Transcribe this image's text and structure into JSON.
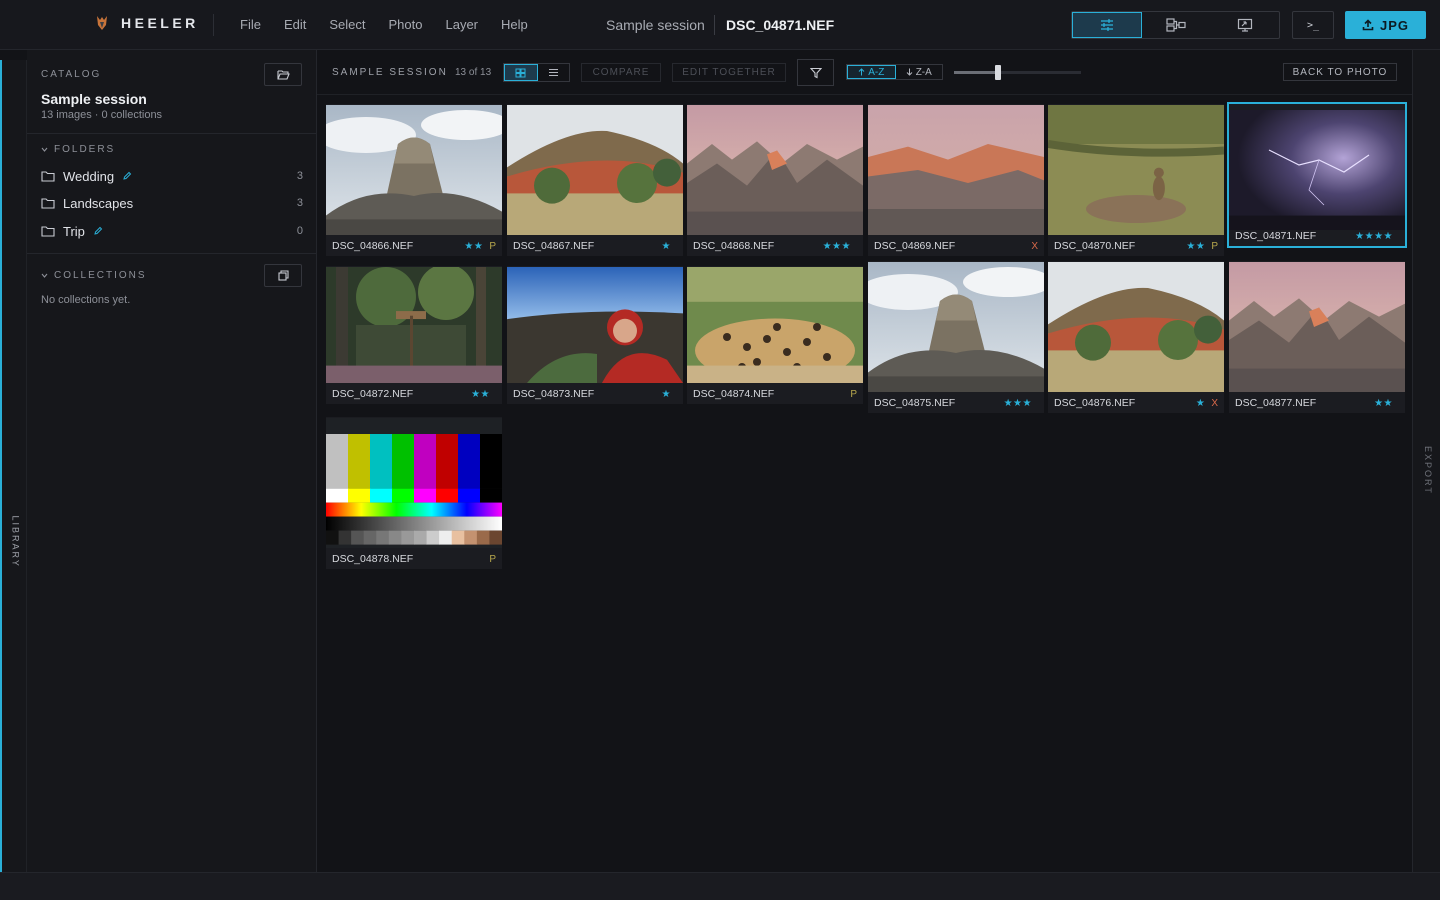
{
  "app": {
    "name": "HEELER"
  },
  "menu": [
    "File",
    "Edit",
    "Select",
    "Photo",
    "Layer",
    "Help"
  ],
  "header": {
    "session": "Sample session",
    "file": "DSC_04871.NEF",
    "export_label": "JPG",
    "terminal": ">_"
  },
  "left_panel": {
    "label": "LIBRARY"
  },
  "right_panel": {
    "label": "EXPORT"
  },
  "catalog": {
    "label": "CATALOG",
    "name": "Sample session",
    "summary": "13 images · 0 collections"
  },
  "folders": {
    "label": "FOLDERS",
    "items": [
      {
        "name": "Wedding",
        "count": "3",
        "editable": true
      },
      {
        "name": "Landscapes",
        "count": "3",
        "editable": false
      },
      {
        "name": "Trip",
        "count": "0",
        "editable": true
      }
    ]
  },
  "collections": {
    "label": "COLLECTIONS",
    "empty": "No collections yet."
  },
  "toolbar": {
    "title": "SAMPLE SESSION",
    "count": "13 of 13",
    "compare": "COMPARE",
    "edit_together": "EDIT TOGETHER",
    "sort_asc": "A-Z",
    "sort_desc": "Z-A",
    "back": "BACK TO PHOTO",
    "zoom_level": 0.35
  },
  "colors": {
    "accent": "#2ab0d8",
    "pick": "#b8a84d",
    "reject": "#d9694a"
  },
  "photos": [
    {
      "name": "DSC_04866.NEF",
      "stars": "★★",
      "flag": "P",
      "scene": "tower"
    },
    {
      "name": "DSC_04867.NEF",
      "stars": "★",
      "flag": "",
      "scene": "redhill"
    },
    {
      "name": "DSC_04868.NEF",
      "stars": "★★★",
      "flag": "",
      "scene": "badlands"
    },
    {
      "name": "DSC_04869.NEF",
      "stars": "",
      "flag": "X",
      "scene": "badlands2"
    },
    {
      "name": "DSC_04870.NEF",
      "stars": "★★",
      "flag": "P",
      "scene": "prairie"
    },
    {
      "name": "DSC_04871.NEF",
      "stars": "★★★★",
      "flag": "",
      "scene": "storm"
    },
    {
      "name": "DSC_04872.NEF",
      "stars": "★★",
      "flag": "",
      "scene": "forest"
    },
    {
      "name": "DSC_04873.NEF",
      "stars": "★",
      "flag": "",
      "scene": "selfie"
    },
    {
      "name": "DSC_04874.NEF",
      "stars": "",
      "flag": "P",
      "scene": "leopard"
    },
    {
      "name": "DSC_04875.NEF",
      "stars": "★★★",
      "flag": "",
      "scene": "tower"
    },
    {
      "name": "DSC_04876.NEF",
      "stars": "★",
      "flag": "X",
      "scene": "redhill"
    },
    {
      "name": "DSC_04877.NEF",
      "stars": "★★",
      "flag": "",
      "scene": "badlands"
    },
    {
      "name": "DSC_04878.NEF",
      "stars": "",
      "flag": "P",
      "scene": "bars"
    }
  ]
}
